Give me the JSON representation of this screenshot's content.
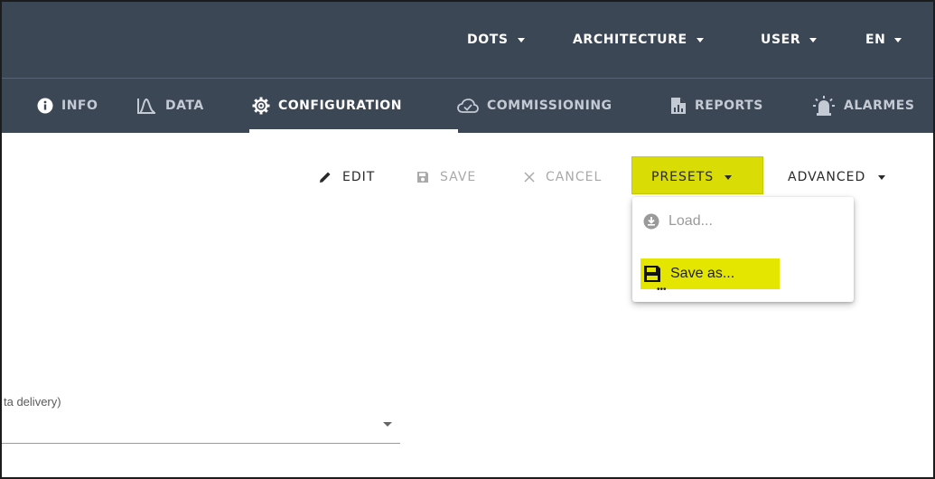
{
  "topbar": {
    "menus": [
      {
        "label": "DOTS"
      },
      {
        "label": "ARCHITECTURE"
      },
      {
        "label": "USER"
      },
      {
        "label": "EN"
      }
    ]
  },
  "nav": {
    "tabs": [
      {
        "label": "INFO",
        "icon": "info-icon"
      },
      {
        "label": "DATA",
        "icon": "chart-icon"
      },
      {
        "label": "CONFIGURATION",
        "icon": "gear-icon",
        "active": true
      },
      {
        "label": "COMMISSIONING",
        "icon": "cloud-check-icon"
      },
      {
        "label": "REPORTS",
        "icon": "report-icon"
      },
      {
        "label": "ALARMES",
        "icon": "alarm-light-icon"
      }
    ]
  },
  "toolbar": {
    "edit_label": "EDIT",
    "save_label": "SAVE",
    "cancel_label": "CANCEL",
    "presets_label": "PRESETS",
    "advanced_label": "ADVANCED"
  },
  "presets_menu": {
    "items": [
      {
        "label": "Load...",
        "icon": "download-icon",
        "enabled": false
      },
      {
        "label": "Save as...",
        "icon": "floppy-icon",
        "enabled": true
      }
    ]
  },
  "form": {
    "field_label_fragment": "ta delivery)"
  },
  "colors": {
    "header_bg": "#3c4756",
    "highlight": "#d9dd05"
  }
}
